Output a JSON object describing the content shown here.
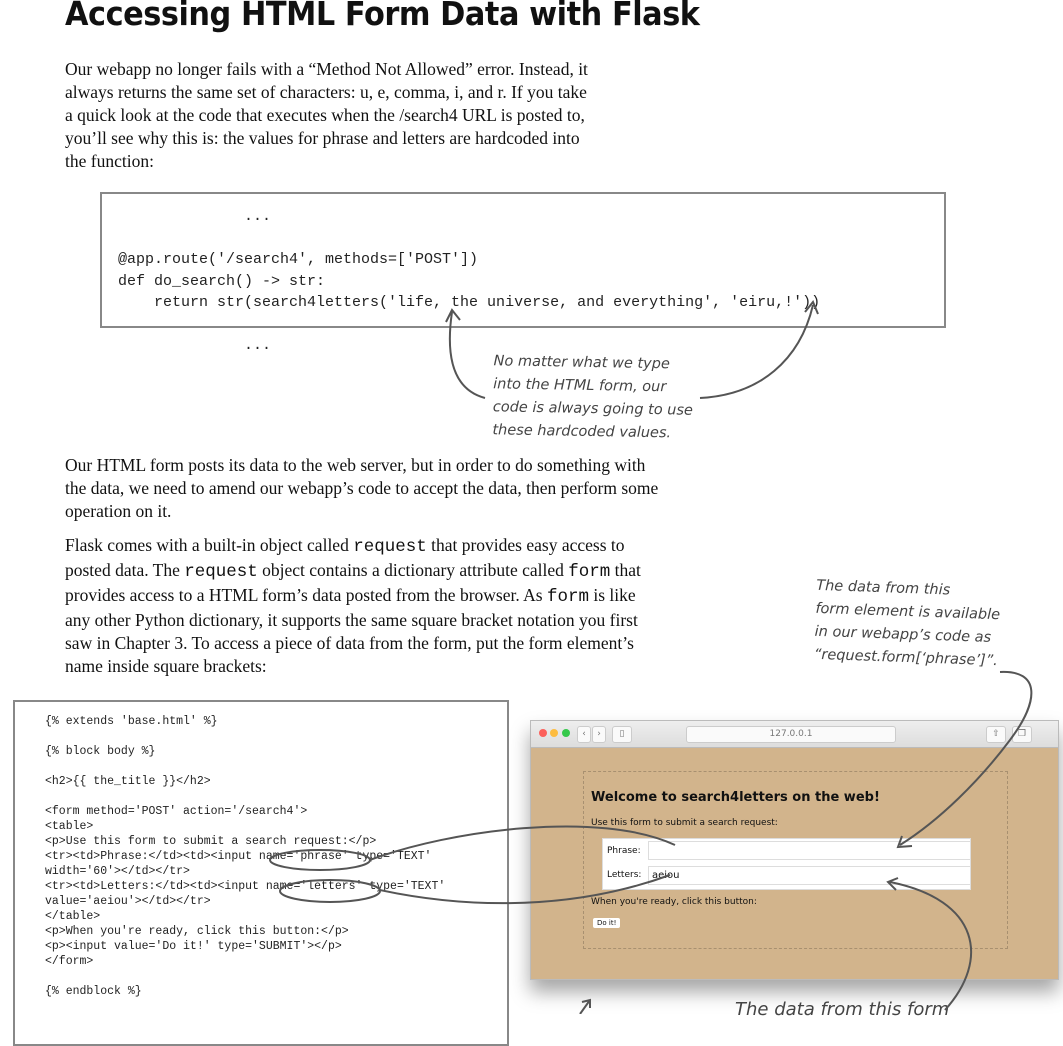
{
  "title": "Accessing HTML Form Data with Flask",
  "para1": [
    "Our webapp no longer fails with a “Method Not Allowed” error. Instead, it",
    "always returns the same set of characters: u, e, comma, i, and r. If you take",
    "a quick look at the code that executes when the /search4 URL is posted to,",
    "you’ll see why this is: the values for phrase and letters are hardcoded into",
    "the function:"
  ],
  "code1": "              ...\n\n@app.route('/search4', methods=['POST'])\ndef do_search() -> str:\n    return str(search4letters('life, the universe, and everything', 'eiru,!'))\n\n              ...",
  "note1": [
    "No matter what we type",
    "into the HTML form, our",
    "code is always going to use",
    "these hardcoded values."
  ],
  "para2": "Our HTML form posts its data to the web server, but in order to do something with the data, we need to amend our webapp’s code to accept the data, then perform some operation on it.",
  "para3": {
    "a": "Flask comes with a built-in object called ",
    "b": "request",
    "c": " that provides easy access to posted data. The ",
    "d": "request",
    "e": " object contains a dictionary attribute called ",
    "f": "form",
    "g": " that provides access to a HTML form’s data posted from the browser. As ",
    "h": "form",
    "i": " is like any other Python dictionary, it supports the same square bracket notation you first saw in Chapter 3. To access a piece of data from the form, put the form element’s name inside square brackets:"
  },
  "note2": [
    "The data from this",
    "form element is available",
    "in our webapp’s code as",
    "“request.form[‘phrase’]”."
  ],
  "code2": "{% extends 'base.html' %}\n\n{% block body %}\n\n<h2>{{ the_title }}</h2>\n\n<form method='POST' action='/search4'>\n<table>\n<p>Use this form to submit a search request:</p>\n<tr><td>Phrase:</td><td><input name='phrase' type='TEXT'\nwidth='60'></td></tr>\n<tr><td>Letters:</td><td><input name='letters' type='TEXT'\nvalue='aeiou'></td></tr>\n</table>\n<p>When you're ready, click this button:</p>\n<p><input value='Do it!' type='SUBMIT'></p>\n</form>\n\n{% endblock %}",
  "browser": {
    "url": "127.0.0.1",
    "heading": "Welcome to search4letters on the web!",
    "intro": "Use this form to submit a search request:",
    "phrase_label": "Phrase:",
    "phrase_value": "",
    "letters_label": "Letters:",
    "letters_value": "aeiou",
    "ready": "When you're ready, click this button:",
    "button": "Do it!"
  },
  "note3": "The data from this form"
}
